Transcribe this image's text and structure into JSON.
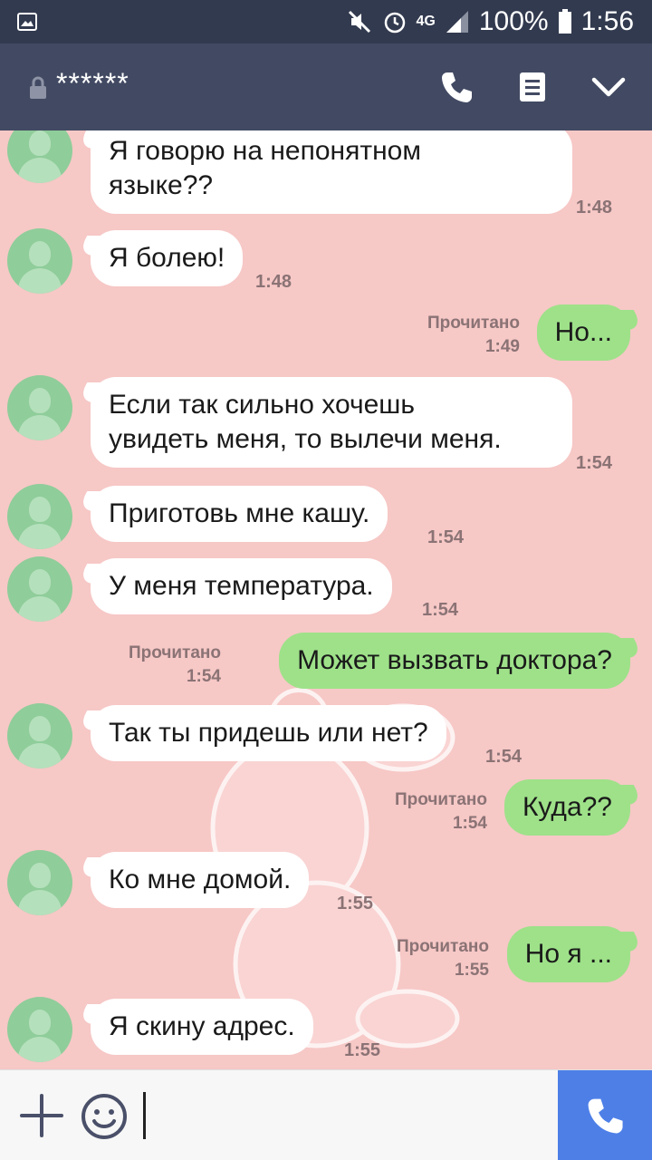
{
  "status_bar": {
    "battery": "100%",
    "time": "1:56",
    "network": "4G"
  },
  "header": {
    "title": "******"
  },
  "messages": [
    {
      "dir": "in",
      "text_lines": [
        "Я говорю на непонятном",
        "языке??"
      ],
      "time": "1:48"
    },
    {
      "dir": "in",
      "text": "Я болею!",
      "time": "1:48"
    },
    {
      "dir": "out",
      "text": "Но...",
      "read": "Прочитано",
      "time": "1:49"
    },
    {
      "dir": "in",
      "text_lines": [
        "Если так сильно хочешь",
        "увидеть меня, то вылечи меня."
      ],
      "time": "1:54"
    },
    {
      "dir": "in",
      "text": "Приготовь мне кашу.",
      "time": "1:54"
    },
    {
      "dir": "in",
      "text": "У меня температура.",
      "time": "1:54"
    },
    {
      "dir": "out",
      "text": "Может вызвать доктора?",
      "read": "Прочитано",
      "time": "1:54"
    },
    {
      "dir": "in",
      "text": "Так ты придешь или нет?",
      "time": "1:54"
    },
    {
      "dir": "out",
      "text": "Куда??",
      "read": "Прочитано",
      "time": "1:54"
    },
    {
      "dir": "in",
      "text": "Ко мне домой.",
      "time": "1:55"
    },
    {
      "dir": "out",
      "text": "Но я ...",
      "read": "Прочитано",
      "time": "1:55"
    },
    {
      "dir": "in",
      "text": "Я скину адрес.",
      "time": "1:55"
    }
  ],
  "input": {
    "value": ""
  },
  "icons": {
    "gallery": "image-icon",
    "mute": "mute-icon",
    "alarm": "alarm-icon",
    "signal": "signal-icon",
    "battery": "battery-icon",
    "lock": "lock-icon",
    "call": "phone-icon",
    "notes": "note-icon",
    "menu": "chevron-down-icon",
    "add": "plus-icon",
    "emoji": "emoji-icon",
    "send": "phone-icon"
  },
  "colors": {
    "background": "#f6c8c6",
    "header": "#424a63",
    "status_bar": "#323a4f",
    "incoming_bubble": "#ffffff",
    "outgoing_bubble": "#9ee189",
    "call_button": "#4d7fe7"
  }
}
